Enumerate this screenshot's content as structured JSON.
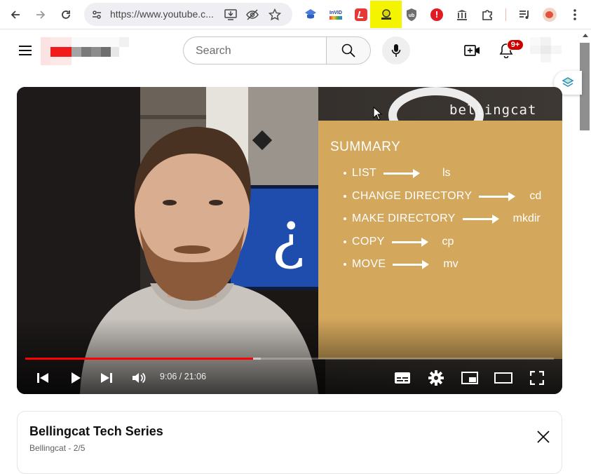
{
  "browser": {
    "url": "https://www.youtube.c...",
    "nav": {
      "back": "back-icon",
      "forward": "forward-icon",
      "reload": "reload-icon"
    },
    "extensions": [
      {
        "name": "translate-extension-icon"
      },
      {
        "name": "invid-extension-icon",
        "label": "InVID"
      },
      {
        "name": "red-extension-icon"
      },
      {
        "name": "yellow-extension-icon"
      },
      {
        "name": "ublock-extension-icon"
      },
      {
        "name": "alert-extension-icon"
      },
      {
        "name": "archive-extension-icon"
      },
      {
        "name": "puzzle-extensions-icon"
      },
      {
        "name": "media-control-icon"
      },
      {
        "name": "profile-avatar-icon"
      },
      {
        "name": "more-vert-icon"
      }
    ]
  },
  "youtube": {
    "search_placeholder": "Search",
    "notifications_badge": "9+",
    "colors": {
      "brand_red": "#ff0000",
      "badge": "#cc0000"
    }
  },
  "player": {
    "watermark": "bellingcat",
    "summary": {
      "title": "SUMMARY",
      "commands": [
        {
          "term": "LIST",
          "result": "ls"
        },
        {
          "term": "CHANGE DIRECTORY",
          "result": "cd"
        },
        {
          "term": "MAKE DIRECTORY",
          "result": "mkdir"
        },
        {
          "term": "COPY",
          "result": "cp"
        },
        {
          "term": "MOVE",
          "result": "mv"
        }
      ]
    },
    "current_time": "9:06",
    "duration": "21:06",
    "time_display": "9:06 / 21:06",
    "progress_played_fraction": 0.431,
    "progress_buffered_fraction": 0.445
  },
  "playlist": {
    "title": "Bellingcat Tech Series",
    "meta": "Bellingcat - 2/5"
  }
}
